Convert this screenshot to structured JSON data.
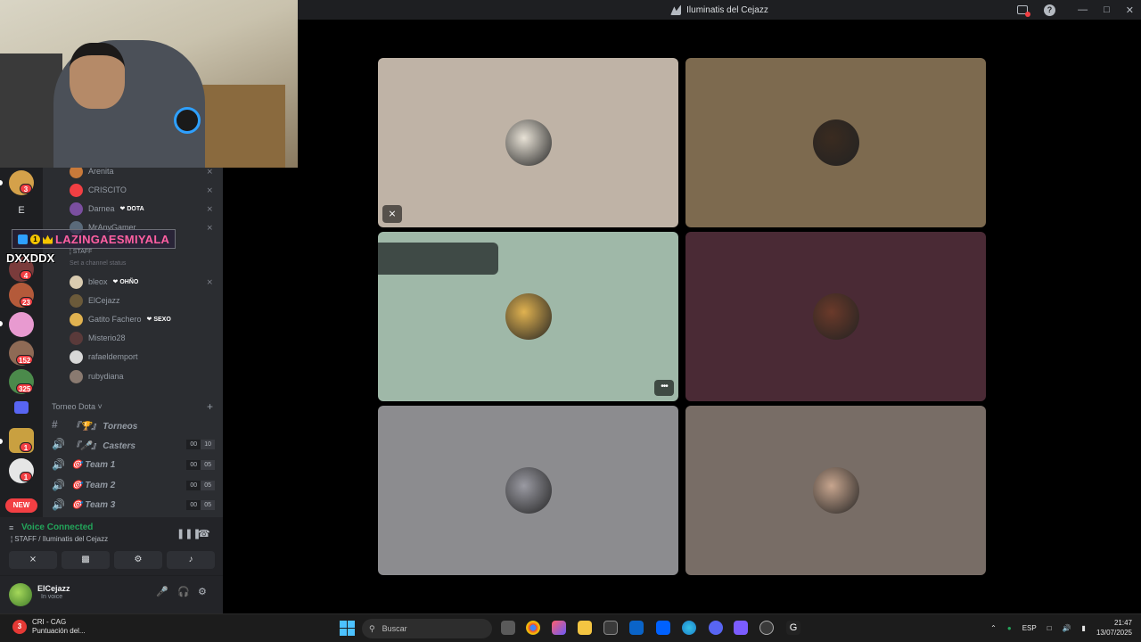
{
  "window": {
    "title": "Iluminatis del Cejazz"
  },
  "colors": {
    "accent": "#5865f2",
    "online": "#23a55a",
    "danger": "#f23f43"
  },
  "overlay": {
    "name": "LAZINGAESMIYALA",
    "badge_num": "1",
    "subtitle": "DXXDDX"
  },
  "servers": {
    "letter": "E",
    "badges": [
      "3",
      "4",
      "23",
      "152",
      "325",
      "1",
      "1"
    ],
    "new_label": "NEW"
  },
  "members_top": [
    {
      "name": "Arenita",
      "tag": ""
    },
    {
      "name": "CRISCITO",
      "tag": ""
    },
    {
      "name": "Darnea",
      "tag": "❤ DOTA"
    },
    {
      "name": "MrAnyGamer",
      "tag": ""
    }
  ],
  "staff_channel": {
    "label": "¦ STAFF",
    "status_placeholder": "Set a channel status"
  },
  "members": [
    {
      "name": "bleox",
      "tag": "❤ OHÑO"
    },
    {
      "name": "ElCejazz",
      "tag": ""
    },
    {
      "name": "Gatito Fachero",
      "tag": "❤ SEXO"
    },
    {
      "name": "Misterio28",
      "tag": ""
    },
    {
      "name": "rafaeldemport",
      "tag": ""
    },
    {
      "name": "rubydiana",
      "tag": ""
    }
  ],
  "category": {
    "label": "Torneo Dota",
    "chevron": "˅"
  },
  "voice_channels": [
    {
      "name": "『🏆』 Torneos",
      "icon": "#",
      "count": "",
      "limit": ""
    },
    {
      "name": "『🎤』 Casters",
      "icon": "🔊",
      "count": "00",
      "limit": "10"
    },
    {
      "name": "🎯 Team 1",
      "icon": "🔊",
      "count": "00",
      "limit": "05"
    },
    {
      "name": "🎯 Team 2",
      "icon": "🔊",
      "count": "00",
      "limit": "05"
    },
    {
      "name": "🎯 Team 3",
      "icon": "🔊",
      "count": "00",
      "limit": "05"
    }
  ],
  "voice": {
    "status": "Voice Connected",
    "location": "¦ STAFF / Iluminatis del Cejazz"
  },
  "user": {
    "name": "ElCejazz",
    "status": "In voice"
  },
  "tiles": [
    {
      "bg": "#bfb3a6",
      "avatar": "#e8e2d6",
      "muted": true,
      "more": false,
      "banner": false
    },
    {
      "bg": "#7d6a4f",
      "avatar": "#3a2b20",
      "muted": false,
      "more": false,
      "banner": false
    },
    {
      "bg": "#9fb8a8",
      "avatar": "#e0b250",
      "muted": false,
      "more": true,
      "banner": true
    },
    {
      "bg": "#4a2a35",
      "avatar": "#6b3a2a",
      "muted": false,
      "more": false,
      "banner": false
    },
    {
      "bg": "#8c8c8f",
      "avatar": "#9a9aa2",
      "muted": false,
      "more": false,
      "banner": false
    },
    {
      "bg": "#786d66",
      "avatar": "#c7a58e",
      "muted": false,
      "more": false,
      "banner": false
    }
  ],
  "taskbar": {
    "news_title": "CRI - CAG",
    "news_sub": "Puntuación del...",
    "news_badge": "3",
    "search_placeholder": "Buscar",
    "lang": "ESP",
    "time": "21:47",
    "date": "13/07/2025"
  }
}
